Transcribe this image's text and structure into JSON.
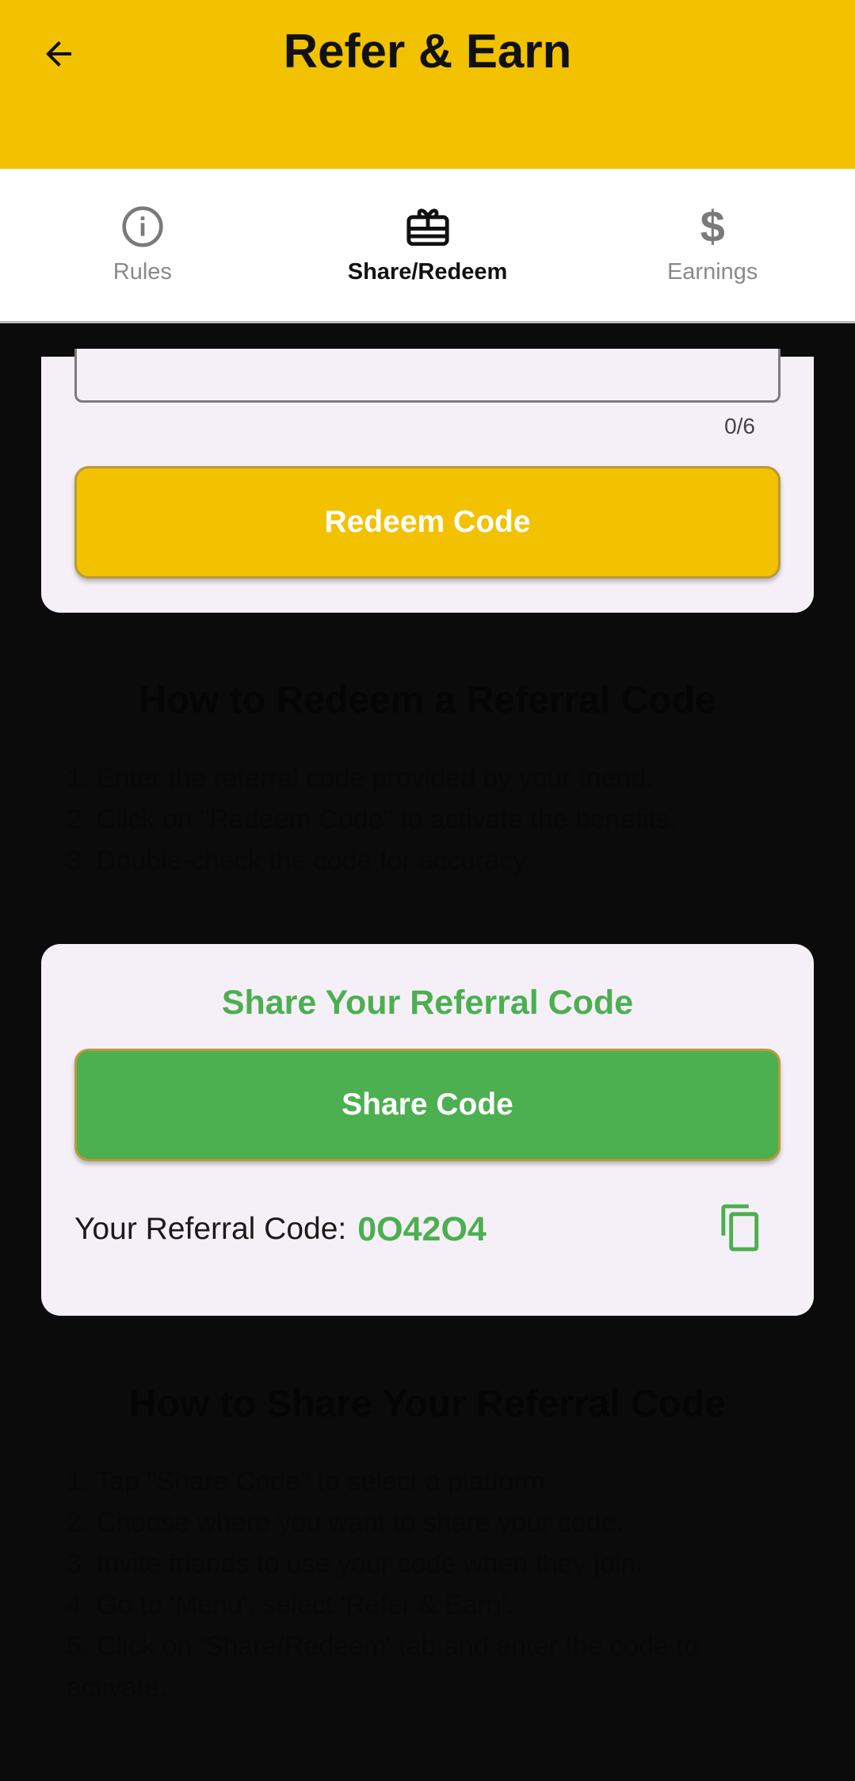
{
  "header": {
    "title": "Refer & Earn",
    "back_icon": "arrow-back-icon",
    "background": "#f2c200"
  },
  "tabs": [
    {
      "label": "Rules",
      "icon": "info-circle-icon",
      "active": false
    },
    {
      "label": "Share/Redeem",
      "icon": "gift-card-icon",
      "active": true
    },
    {
      "label": "Earnings",
      "icon": "dollar-icon",
      "active": false
    }
  ],
  "redeem_card": {
    "input_value": "",
    "counter": "0/6",
    "button_label": "Redeem Code"
  },
  "redeem_help": {
    "heading": "How to Redeem a Referral Code",
    "steps": [
      "1. Enter the referral code provided by your friend.",
      "2. Click on \"Redeem Code\" to activate the benefits.",
      "3. Double-check the code for accuracy."
    ]
  },
  "share_card": {
    "title": "Share Your Referral Code",
    "button_label": "Share Code",
    "code_label": "Your Referral Code:",
    "code_value": "0O42O4",
    "copy_icon": "copy-icon",
    "accent": "#4caf50"
  },
  "share_help": {
    "heading": "How to Share Your Referral Code",
    "steps": [
      "1. Tap \"Share Code\" to select a platform.",
      "2. Choose where you want to share your code.",
      "3. Invite friends to use your code when they join.",
      "4. Go to 'Menu', select 'Refer & Earn'.",
      "5. Click on 'Share/Redeem' tab and enter the code to activate."
    ]
  }
}
